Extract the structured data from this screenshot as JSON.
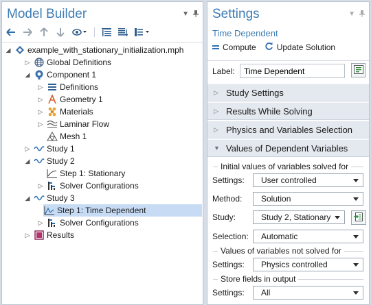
{
  "model_builder": {
    "title": "Model Builder",
    "toolbar": [
      "back-arrow-icon",
      "forward-arrow-icon",
      "up-arrow-icon",
      "down-arrow-icon",
      "show-icon",
      "expand-sections-icon",
      "collapse-sections-icon",
      "list-view-icon"
    ],
    "tree": [
      {
        "label": "example_with_stationary_initialization.mph",
        "icon": "model-file-icon"
      },
      {
        "label": "Global Definitions",
        "icon": "globe-icon"
      },
      {
        "label": "Component 1",
        "icon": "component-icon"
      },
      {
        "label": "Definitions",
        "icon": "definitions-icon"
      },
      {
        "label": "Geometry 1",
        "icon": "geometry-icon"
      },
      {
        "label": "Materials",
        "icon": "materials-icon"
      },
      {
        "label": "Laminar Flow",
        "icon": "laminar-flow-icon"
      },
      {
        "label": "Mesh 1",
        "icon": "mesh-icon"
      },
      {
        "label": "Study 1",
        "icon": "study-icon"
      },
      {
        "label": "Study 2",
        "icon": "study-icon"
      },
      {
        "label": "Step 1: Stationary",
        "icon": "stationary-step-icon"
      },
      {
        "label": "Solver Configurations",
        "icon": "solver-config-icon"
      },
      {
        "label": "Study 3",
        "icon": "study-icon"
      },
      {
        "label": "Step 1: Time Dependent",
        "icon": "time-dependent-step-icon"
      },
      {
        "label": "Solver Configurations",
        "icon": "solver-config-icon"
      },
      {
        "label": "Results",
        "icon": "results-icon"
      }
    ]
  },
  "settings": {
    "title": "Settings",
    "subtitle": "Time Dependent",
    "compute_label": "Compute",
    "update_label": "Update Solution",
    "label_key": "Label:",
    "label_value": "Time Dependent",
    "sections": {
      "study_settings": "Study Settings",
      "results_while_solving": "Results While Solving",
      "physics_selection": "Physics and Variables Selection",
      "values_dependent": "Values of Dependent Variables"
    },
    "groups": {
      "initial_values": "Initial values of variables solved for",
      "not_solved": "Values of variables not solved for",
      "store_fields": "Store fields in output"
    },
    "fields": {
      "settings1_key": "Settings:",
      "settings1_value": "User controlled",
      "method_key": "Method:",
      "method_value": "Solution",
      "study_key": "Study:",
      "study_value": "Study 2, Stationary",
      "selection_key": "Selection:",
      "selection_value": "Automatic",
      "settings2_key": "Settings:",
      "settings2_value": "Physics controlled",
      "settings3_key": "Settings:",
      "settings3_value": "All"
    }
  },
  "colors": {
    "title": "#3f7db5",
    "selected_row": "#c7dcf4",
    "section_bg": "#e4e9ef"
  }
}
